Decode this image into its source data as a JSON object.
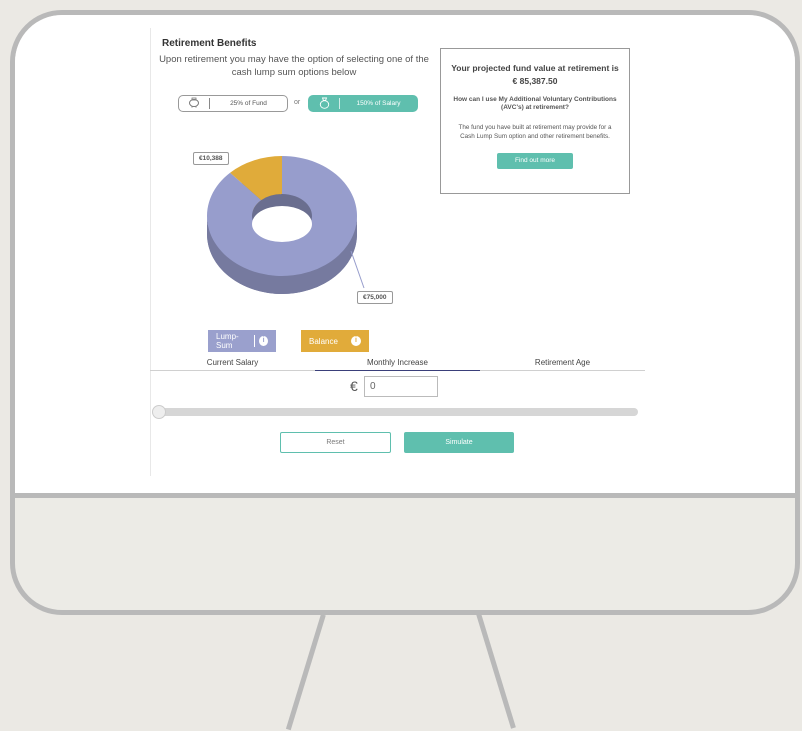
{
  "section_title": "Retirement Benefits",
  "intro": "Upon retirement you may have the option of selecting one of the cash lump sum options below",
  "options": {
    "fund_icon": "piggy-bank-icon",
    "fund_label": "25% of Fund",
    "or": "or",
    "salary_icon": "money-bag-icon",
    "salary_label": "150% of Salary"
  },
  "chart_data": {
    "type": "pie",
    "donut": true,
    "slices": [
      {
        "label": "Lump-Sum",
        "value": 75000,
        "display": "€75,000",
        "color": "#979dcc"
      },
      {
        "label": "Balance",
        "value": 10388,
        "display": "€10,388",
        "color": "#e0ab3a"
      }
    ]
  },
  "legend": {
    "lump_sum": "Lump-Sum",
    "balance": "Balance",
    "info_icon": "info-icon"
  },
  "fund_box": {
    "title": "Your projected fund value at retirement is",
    "value": "€ 85,387.50",
    "question": "How can I use My Additional Voluntary Contributions (AVC's) at retirement?",
    "text": "The fund you have built at retirement may provide for a Cash Lump Sum option and other retirement benefits.",
    "button": "Find out more"
  },
  "tabs": [
    {
      "label": "Current Salary"
    },
    {
      "label": "Monthly Increase",
      "active": true
    },
    {
      "label": "Retirement Age"
    }
  ],
  "input": {
    "currency": "€",
    "value": "0",
    "slider_value": 0
  },
  "buttons": {
    "reset": "Reset",
    "simulate": "Simulate"
  },
  "colors": {
    "accent": "#5fbfae",
    "lump_sum": "#979dcc",
    "balance": "#e0ab3a",
    "tab_active": "#3a3f7a"
  }
}
